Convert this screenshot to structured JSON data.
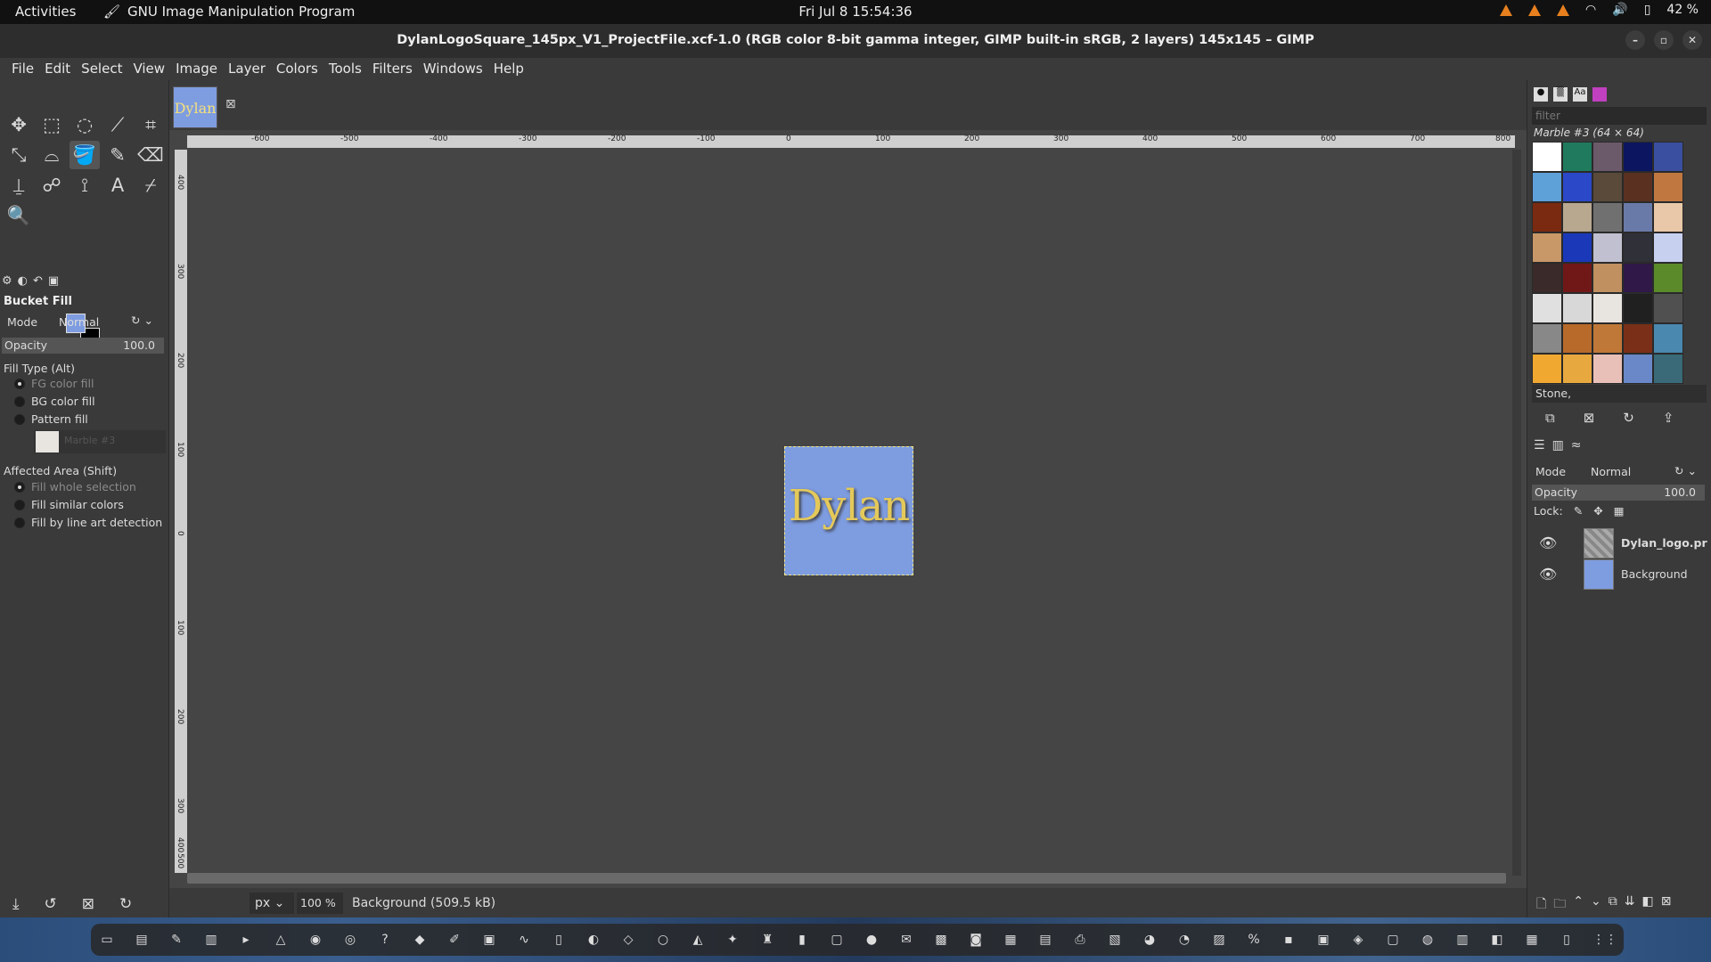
{
  "topbar": {
    "activities": "Activities",
    "app_name": "GNU Image Manipulation Program",
    "clock": "Fri Jul 8  15:54:36",
    "battery": "42 %"
  },
  "window": {
    "title": "DylanLogoSquare_145px_V1_ProjectFile.xcf-1.0 (RGB color 8-bit gamma integer, GIMP built-in sRGB, 2 layers) 145x145 – GIMP"
  },
  "menu": [
    "File",
    "Edit",
    "Select",
    "View",
    "Image",
    "Layer",
    "Colors",
    "Tools",
    "Filters",
    "Windows",
    "Help"
  ],
  "tool_options": {
    "title": "Bucket Fill",
    "mode_label": "Mode",
    "mode_value": "Normal",
    "opacity_label": "Opacity",
    "opacity_value": "100.0",
    "fill_type_label": "Fill Type  (Alt)",
    "fill_types": [
      "FG color fill",
      "BG color fill",
      "Pattern fill"
    ],
    "pattern_name": "Marble #3",
    "affected_area_label": "Affected Area  (Shift)",
    "affected_areas": [
      "Fill whole selection",
      "Fill similar colors",
      "Fill by line art detection"
    ]
  },
  "image_tab": {
    "thumb_text": "Dylan"
  },
  "canvas": {
    "image_text": "Dylan",
    "image_bg_color": "#7e9ce0",
    "text_color": "#e4c95a"
  },
  "ruler_labels": [
    "-600",
    "-500",
    "-400",
    "-300",
    "-200",
    "-100",
    "0",
    "100",
    "200",
    "300",
    "400",
    "500",
    "600",
    "700",
    "800"
  ],
  "ruler_labels_v": [
    "400",
    "300",
    "200",
    "100",
    "0",
    "100",
    "200",
    "300",
    "400",
    "500"
  ],
  "status": {
    "unit": "px",
    "zoom": "100 %",
    "message": "Background (509.5 kB)"
  },
  "patterns": {
    "filter_placeholder": "filter",
    "selected_name": "Marble #3 (64 × 64)",
    "tag": "Stone,",
    "swatches": [
      "#ffffff",
      "#1f7a5e",
      "#6b5a6a",
      "#0b1560",
      "#3a4fa0",
      "#5ea0d8",
      "#2a48c8",
      "#5a4a3a",
      "#5a3020",
      "#c07840",
      "#7a2a10",
      "#b8a890",
      "#707070",
      "#6a7aa8",
      "#e8c8a8",
      "#c89868",
      "#1a38b8",
      "#c0c0d0",
      "#303038",
      "#c8d0f0",
      "#3a2a2a",
      "#701818",
      "#c09060",
      "#301848",
      "#5a8a2a",
      "#e0e0e0",
      "#d8d8d8",
      "#e8e4e0",
      "#202020",
      "#505050",
      "#888888",
      "#b86a2a",
      "#c07838",
      "#7a3018",
      "#4a88b0",
      "#f0a830",
      "#e8a840",
      "#e8c0b8",
      "#6a88c8",
      "#3a6a78"
    ]
  },
  "layers": {
    "mode_label": "Mode",
    "mode_value": "Normal",
    "opacity_label": "Opacity",
    "opacity_value": "100.0",
    "lock_label": "Lock:",
    "items": [
      {
        "name": "Dylan_logo.pr"
      },
      {
        "name": "Background"
      }
    ]
  }
}
